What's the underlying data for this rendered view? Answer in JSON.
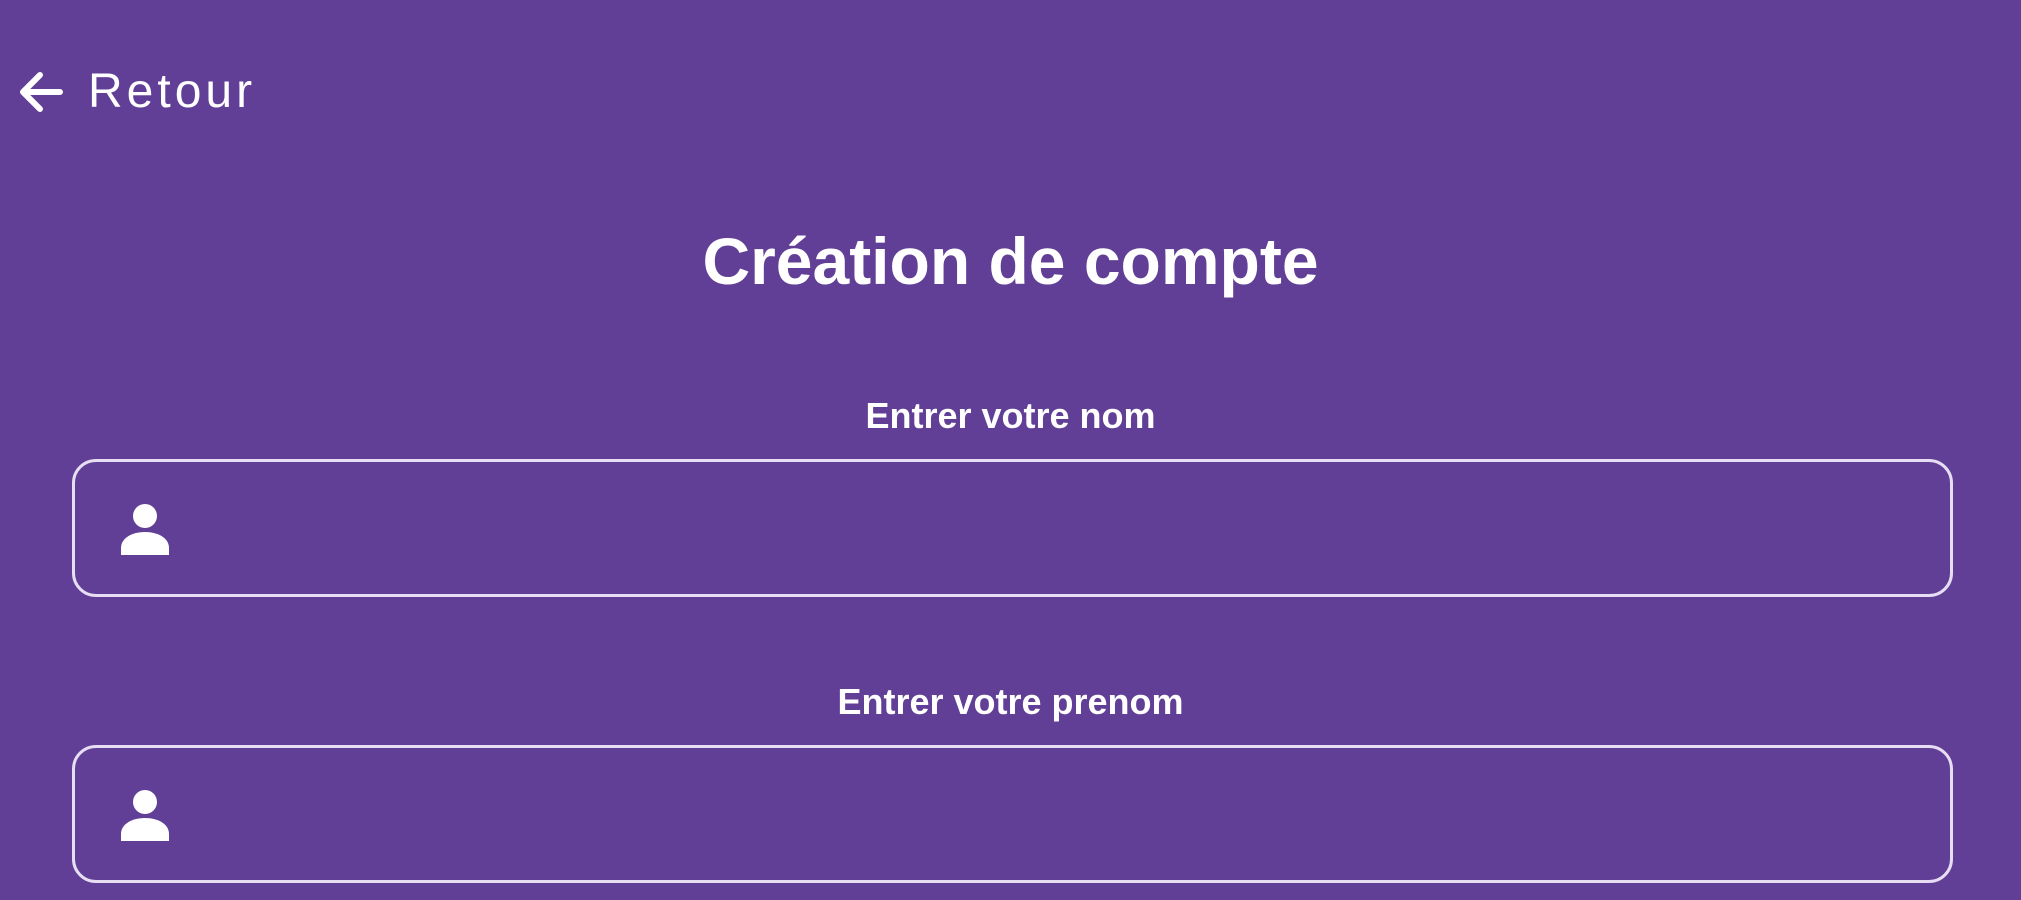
{
  "header": {
    "back_label": "Retour",
    "back_icon": "arrow-left-icon"
  },
  "page": {
    "title": "Création de compte"
  },
  "form": {
    "fields": [
      {
        "label": "Entrer votre nom",
        "value": "",
        "placeholder": "",
        "icon": "user-icon"
      },
      {
        "label": "Entrer votre prenom",
        "value": "",
        "placeholder": "",
        "icon": "user-icon"
      }
    ]
  },
  "colors": {
    "background": "#613f96",
    "text": "#ffffff",
    "field_border": "#e7def3"
  }
}
